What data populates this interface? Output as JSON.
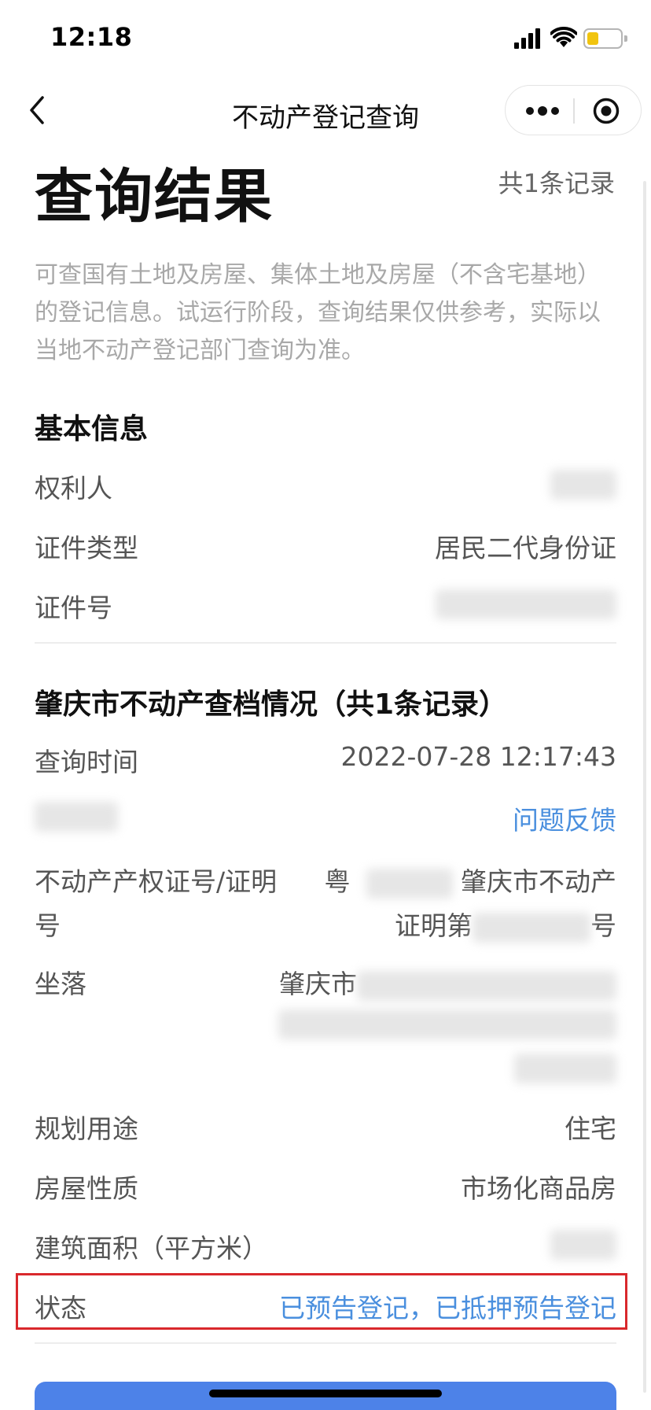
{
  "status_bar": {
    "time": "12:18"
  },
  "nav": {
    "title": "不动产登记查询"
  },
  "header": {
    "title": "查询结果",
    "count": "共1条记录",
    "notice": "可查国有土地及房屋、集体土地及房屋（不含宅基地）的登记信息。试运行阶段，查询结果仅供参考，实际以当地不动产登记部门查询为准。"
  },
  "basic_info": {
    "title": "基本信息",
    "owner_label": "权利人",
    "id_type_label": "证件类型",
    "id_type_value": "居民二代身份证",
    "id_number_label": "证件号"
  },
  "archive": {
    "title": "肇庆市不动产查档情况（共1条记录）",
    "query_time_label": "查询时间",
    "query_time_value": "2022-07-28 12:17:43",
    "feedback_link": "问题反馈",
    "cert_label_line1": "不动产产权证号/证明",
    "cert_label_line2": "号",
    "cert_prefix": "粤",
    "cert_mid": "肇庆市不动产",
    "cert_line2_prefix": "证明第",
    "cert_line2_suffix": "号",
    "location_label": "坐落",
    "location_prefix": "肇庆市",
    "usage_label": "规划用途",
    "usage_value": "住宅",
    "nature_label": "房屋性质",
    "nature_value": "市场化商品房",
    "area_label": "建筑面积（平方米）",
    "status_label": "状态",
    "status_value": "已预告登记，已抵押预告登记"
  },
  "colors": {
    "link": "#4a8fde",
    "highlight": "#d9282c",
    "button": "#4d82e8"
  }
}
